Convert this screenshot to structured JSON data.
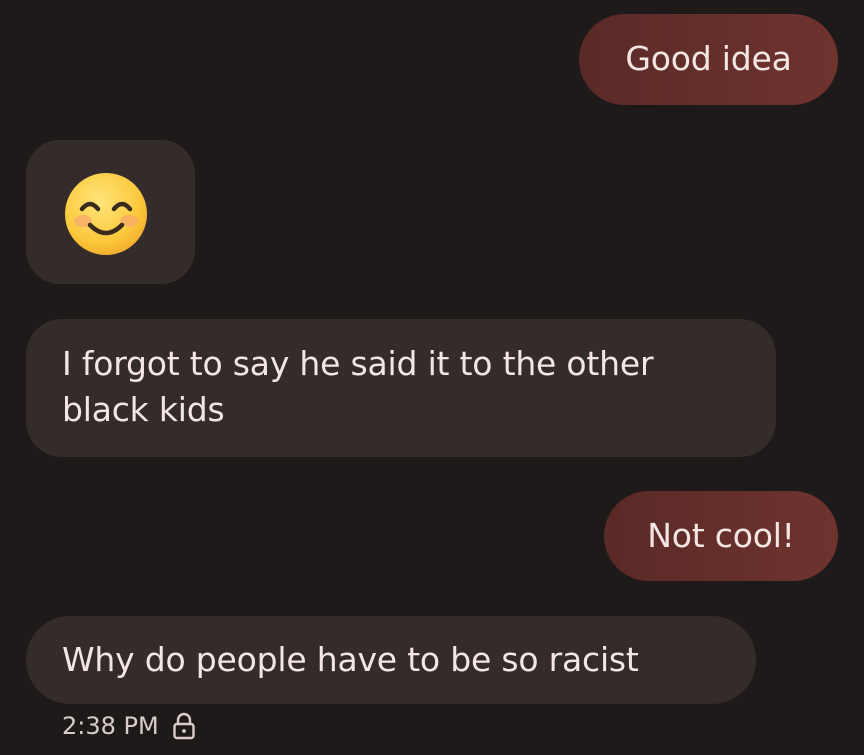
{
  "messages": [
    {
      "direction": "sent",
      "text": "Good idea"
    },
    {
      "direction": "received",
      "emoji": "smiling-face-with-smiling-eyes"
    },
    {
      "direction": "received",
      "text": "I forgot to say he said it to the other black kids"
    },
    {
      "direction": "sent",
      "text": "Not cool!"
    },
    {
      "direction": "received",
      "text": "Why do people have to be so racist"
    }
  ],
  "last_message_meta": {
    "time": "2:38 PM",
    "icon": "lock-icon"
  },
  "colors": {
    "background": "#1f1a1a",
    "sent_bubble": "#6f332f",
    "received_bubble": "#342c2b",
    "text": "#f3e6e3"
  }
}
